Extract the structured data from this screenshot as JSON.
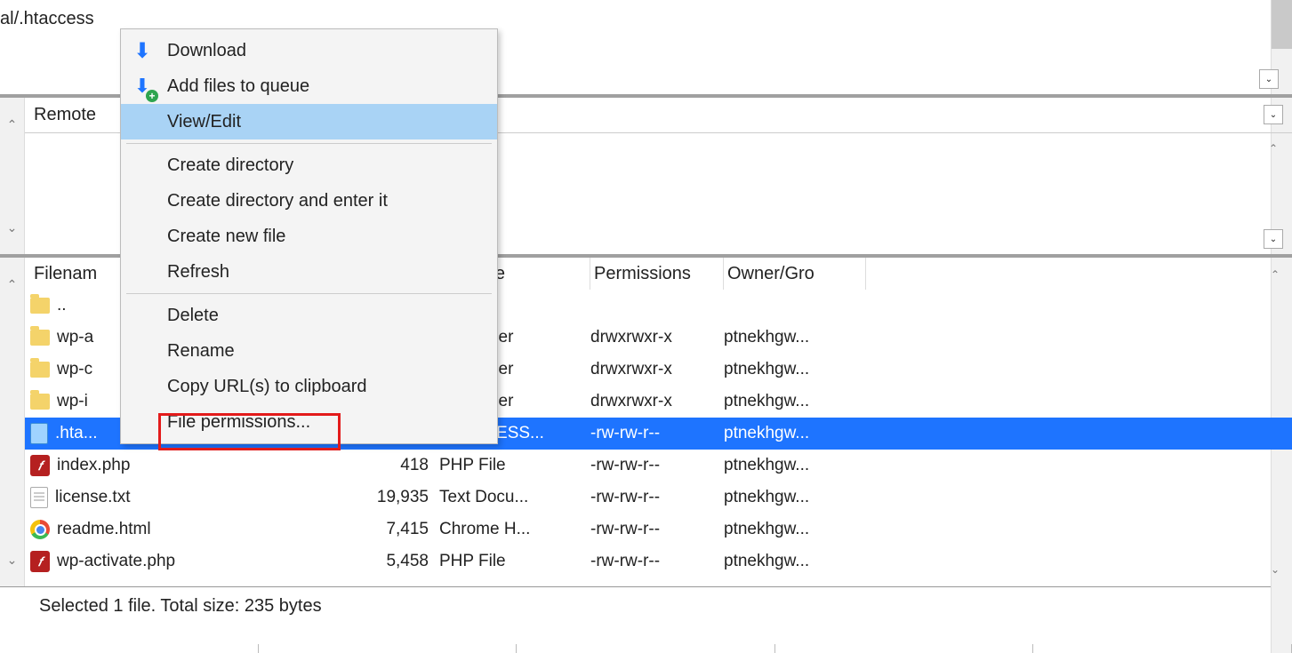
{
  "top_path": "al/.htaccess",
  "remote_label": "Remote",
  "columns": {
    "filename": "Filenam",
    "filesize": "",
    "filetype": "Filetype",
    "permissions": "Permissions",
    "owner": "Owner/Gro"
  },
  "files": [
    {
      "icon": "folder",
      "name": "..",
      "size": "",
      "type": "",
      "perm": "",
      "owner": "",
      "selected": false
    },
    {
      "icon": "folder",
      "name": "wp-a",
      "size": "",
      "type": "File folder",
      "perm": "drwxrwxr-x",
      "owner": "ptnekhgw...",
      "selected": false
    },
    {
      "icon": "folder",
      "name": "wp-c",
      "size": "",
      "type": "File folder",
      "perm": "drwxrwxr-x",
      "owner": "ptnekhgw...",
      "selected": false
    },
    {
      "icon": "folder",
      "name": "wp-i",
      "size": "",
      "type": "File folder",
      "perm": "drwxrwxr-x",
      "owner": "ptnekhgw...",
      "selected": false
    },
    {
      "icon": "bluefile",
      "name": ".hta...",
      "size": "",
      "type": "HTACCESS...",
      "perm": "-rw-rw-r--",
      "owner": "ptnekhgw...",
      "selected": true
    },
    {
      "icon": "flash",
      "name": "index.php",
      "size": "418",
      "type": "PHP File",
      "perm": "-rw-rw-r--",
      "owner": "ptnekhgw...",
      "selected": false
    },
    {
      "icon": "doc",
      "name": "license.txt",
      "size": "19,935",
      "type": "Text Docu...",
      "perm": "-rw-rw-r--",
      "owner": "ptnekhgw...",
      "selected": false
    },
    {
      "icon": "chrome",
      "name": "readme.html",
      "size": "7,415",
      "type": "Chrome H...",
      "perm": "-rw-rw-r--",
      "owner": "ptnekhgw...",
      "selected": false
    },
    {
      "icon": "flash",
      "name": "wp-activate.php",
      "size": "5,458",
      "type": "PHP File",
      "perm": "-rw-rw-r--",
      "owner": "ptnekhgw...",
      "selected": false
    }
  ],
  "context_menu": {
    "download": "Download",
    "add_queue": "Add files to queue",
    "view_edit": "View/Edit",
    "create_dir": "Create directory",
    "create_dir_enter": "Create directory and enter it",
    "create_file": "Create new file",
    "refresh": "Refresh",
    "delete": "Delete",
    "rename": "Rename",
    "copy_url": "Copy URL(s) to clipboard",
    "file_perm": "File permissions..."
  },
  "status_bar": "Selected 1 file. Total size: 235 bytes",
  "glyphs": {
    "down": "⌄",
    "up": "⌃",
    "arrow": "⬇"
  }
}
